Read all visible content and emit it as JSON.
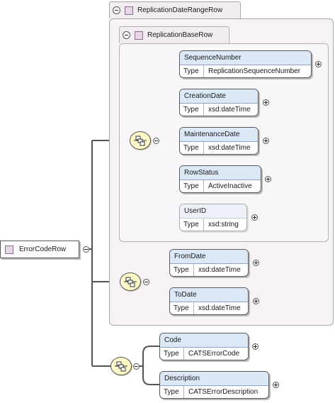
{
  "root": {
    "label": "ErrorCodeRow"
  },
  "groups": {
    "replication_date_range_row": {
      "label": "ReplicationDateRangeRow"
    },
    "replication_base_row": {
      "label": "ReplicationBaseRow"
    }
  },
  "type_key": "Type",
  "elements": {
    "sequence_number": {
      "name": "SequenceNumber",
      "type": "ReplicationSequenceNumber"
    },
    "creation_date": {
      "name": "CreationDate",
      "type": "xsd:dateTime"
    },
    "maintenance_date": {
      "name": "MaintenanceDate",
      "type": "xsd:dateTime"
    },
    "row_status": {
      "name": "RowStatus",
      "type": "ActiveInactive"
    },
    "user_id": {
      "name": "UserID",
      "type": "xsd:string"
    },
    "from_date": {
      "name": "FromDate",
      "type": "xsd:dateTime"
    },
    "to_date": {
      "name": "ToDate",
      "type": "xsd:dateTime"
    },
    "code": {
      "name": "Code",
      "type": "CATSErrorCode"
    },
    "description": {
      "name": "Description",
      "type": "CATSErrorDescription"
    }
  },
  "icons": {
    "collapse": "minus-circle-icon",
    "expand": "plus-circle-icon",
    "sequence": "sequence-compositor-icon",
    "element": "element-square-icon"
  }
}
